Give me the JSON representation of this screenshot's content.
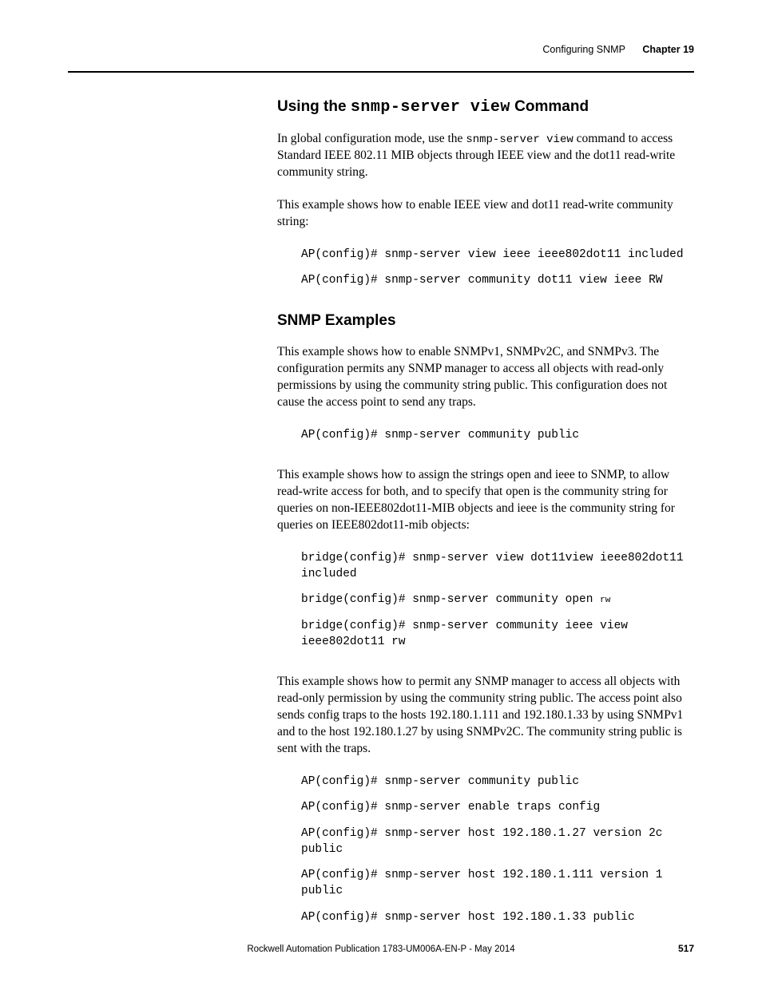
{
  "header": {
    "topic": "Configuring SNMP",
    "chapter": "Chapter 19"
  },
  "section1": {
    "heading_pre": "Using the ",
    "heading_code": "snmp-server view",
    "heading_post": " Command",
    "p1_a": "In global configuration mode, use the ",
    "p1_code": "snmp-server view",
    "p1_b": " command to access Standard IEEE 802.11 MIB objects through IEEE view and the dot11 read-write community string.",
    "p2": "This example shows how to enable IEEE view and dot11 read-write community string:",
    "code1": "AP(config)# snmp-server view ieee ieee802dot11 included",
    "code2": "AP(config)# snmp-server community dot11 view ieee RW"
  },
  "section2": {
    "heading": "SNMP Examples",
    "p1": "This example shows how to enable SNMPv1, SNMPv2C, and SNMPv3. The configuration permits any SNMP manager to access all objects with read-only permissions by using the community string public. This configuration does not cause the access point to send any traps.",
    "code1": "AP(config)# snmp-server community public",
    "p2": "This example shows how to assign the strings open and ieee to SNMP, to allow read-write access for both, and to specify that open is the community string for queries on non-IEEE802dot11-MIB objects and ieee is the community string for queries on IEEE802dot11-mib objects:",
    "code2": "bridge(config)# snmp-server view dot11view ieee802dot11 included",
    "code3a": "bridge(config)# snmp-server community open ",
    "code3b": "rw",
    "code4": "bridge(config)# snmp-server community ieee view ieee802dot11 rw",
    "p3": "This example shows how to permit any SNMP manager to access all objects with read-only permission by using the community string public. The access point also sends config traps to the hosts 192.180.1.111 and 192.180.1.33 by using SNMPv1 and to the host 192.180.1.27 by using SNMPv2C. The community string public is sent with the traps.",
    "code5": "AP(config)# snmp-server community public",
    "code6": "AP(config)# snmp-server enable traps config",
    "code7": "AP(config)# snmp-server host 192.180.1.27 version 2c public",
    "code8": "AP(config)# snmp-server host 192.180.1.111 version 1 public",
    "code9": "AP(config)# snmp-server host 192.180.1.33 public"
  },
  "footer": {
    "pub": "Rockwell Automation Publication 1783-UM006A-EN-P - May 2014",
    "page": "517"
  }
}
